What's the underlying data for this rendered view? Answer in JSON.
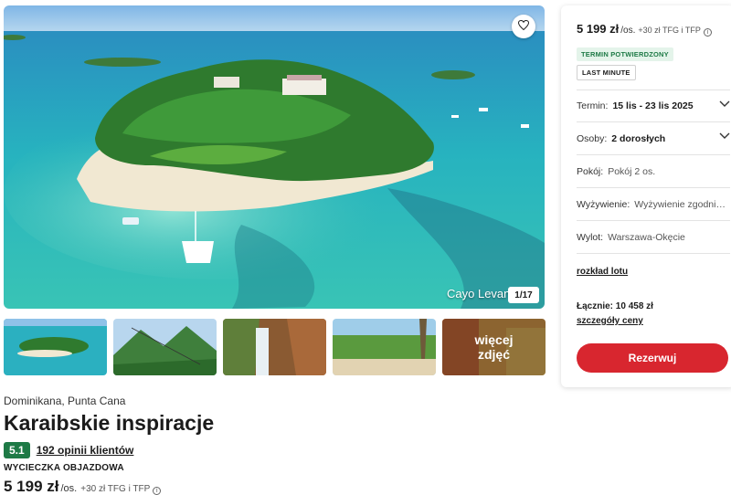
{
  "gallery": {
    "caption": "Cayo Levantado",
    "counter": "1/17",
    "more_photos_label": "więcej zdjęć",
    "icons": {
      "favorite": "heart-icon"
    }
  },
  "offer": {
    "location": "Dominikana, Punta Cana",
    "title": "Karaibskie inspiracje",
    "rating": "5.1",
    "reviews_link": "192 opinii klientów",
    "tour_type": "WYCIECZKA OBJAZDOWA",
    "price": "5 199 zł",
    "price_per": "/os.",
    "price_fees": "+30 zł TFG i TFP"
  },
  "panel": {
    "price": "5 199 zł",
    "price_per": "/os.",
    "price_fees": "+30 zł TFG i TFP",
    "badge_confirmed": "TERMIN POTWIERDZONY",
    "badge_last_minute": "LAST MINUTE",
    "term_label": "Termin:",
    "term_value": "15 lis - 23 lis 2025",
    "persons_label": "Osoby:",
    "persons_value": "2 dorosłych",
    "room_label": "Pokój:",
    "room_value": "Pokój 2 os.",
    "board_label": "Wyżywienie:",
    "board_value": "Wyżywienie zgodnie z programem",
    "departure_label": "Wylot:",
    "departure_value": "Warszawa-Okęcie",
    "flight_link": "rozkład lotu",
    "total": "Łącznie: 10 458 zł",
    "price_details": "szczegóły ceny",
    "reserve_button": "Rezerwuj"
  },
  "colors": {
    "accent_red": "#d8262f",
    "rating_green": "#1e7a46"
  }
}
